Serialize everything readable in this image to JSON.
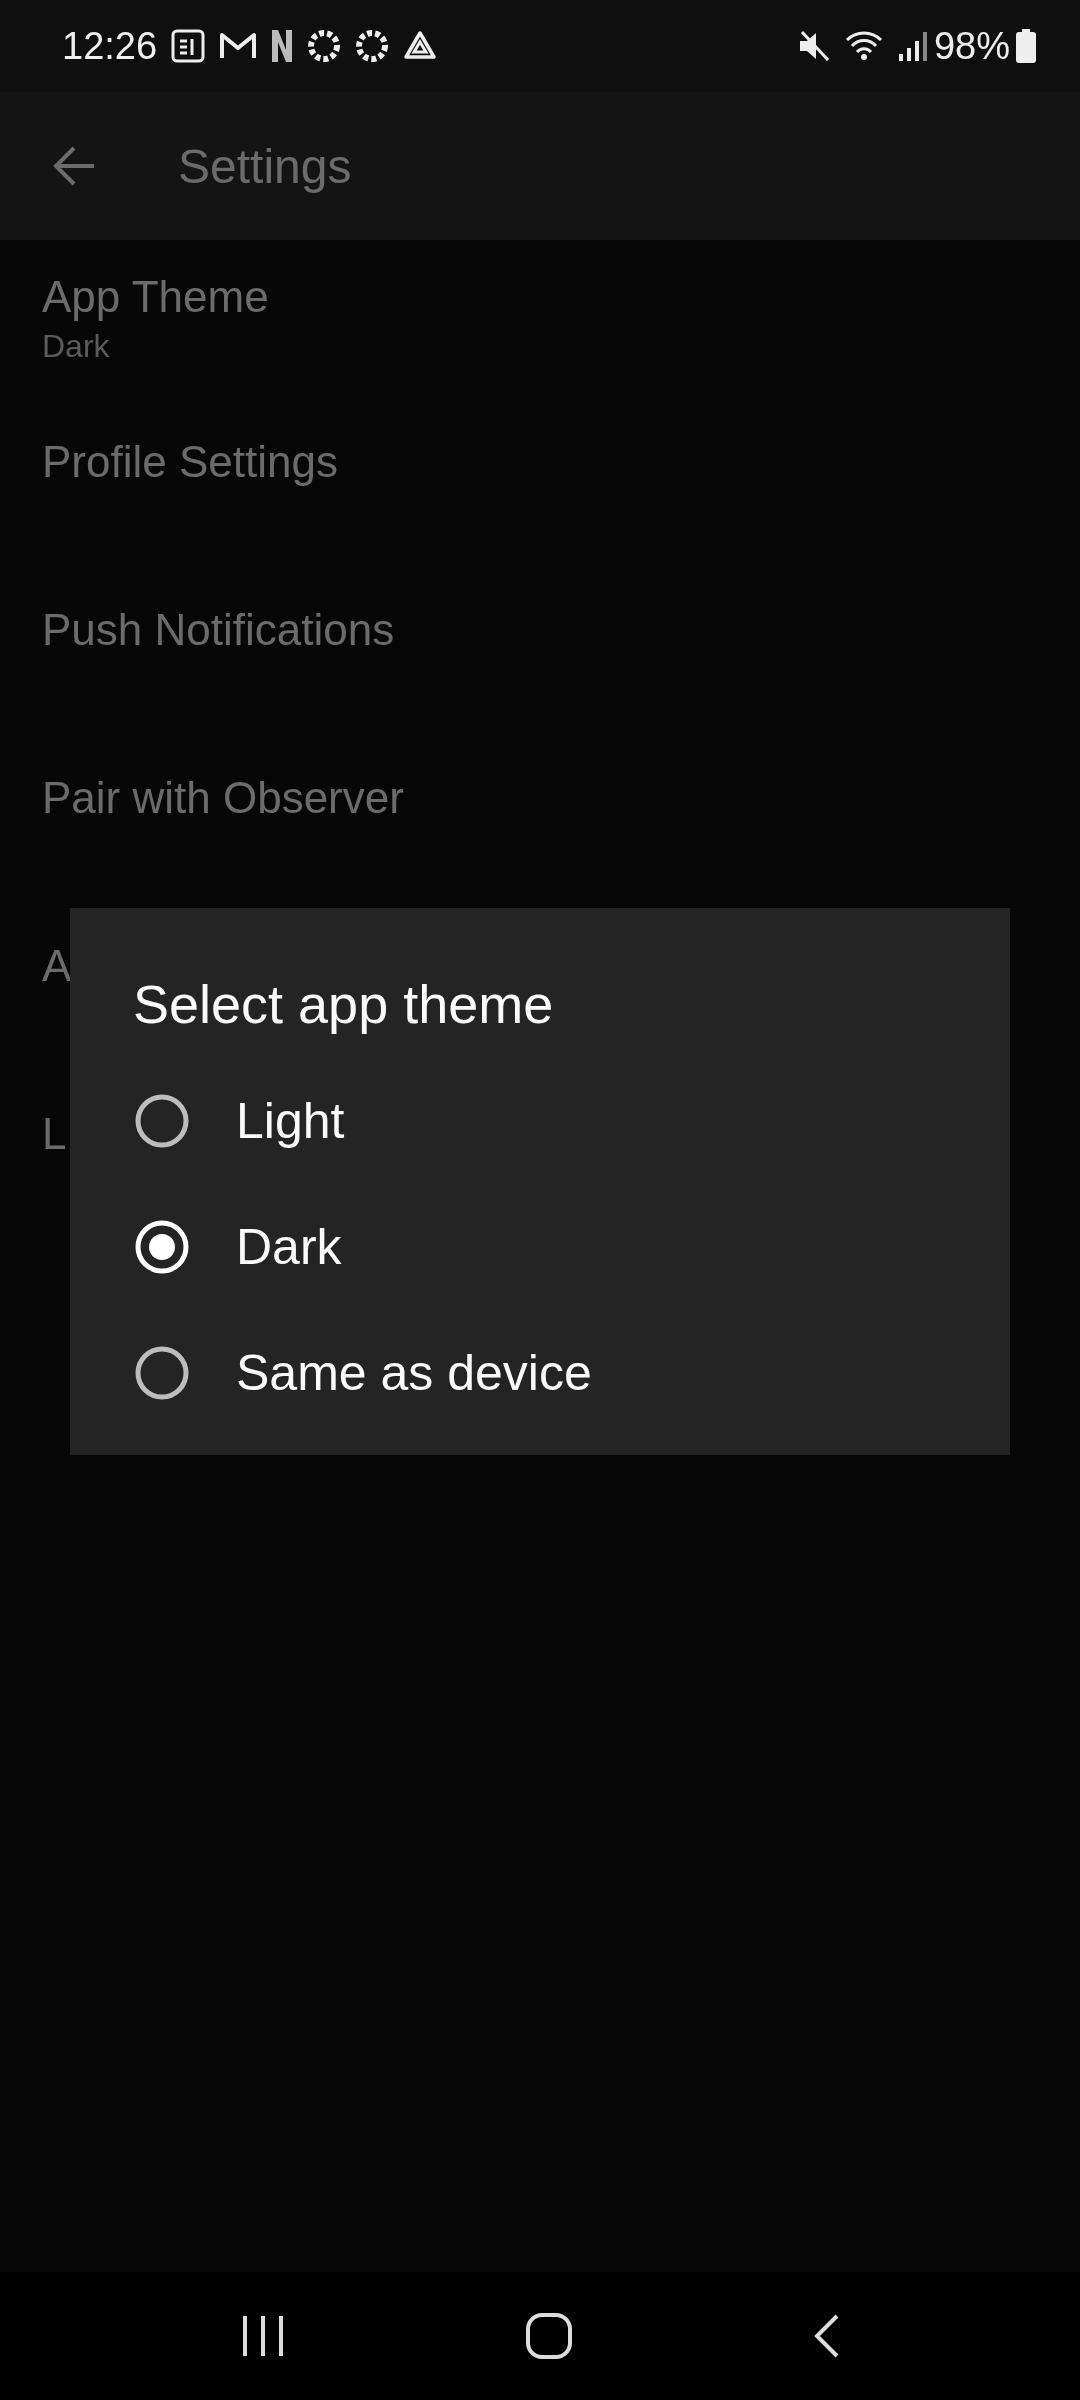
{
  "status_bar": {
    "time": "12:26",
    "battery": "98%"
  },
  "app_bar": {
    "title": "Settings"
  },
  "settings": [
    {
      "title": "App Theme",
      "subtitle": "Dark"
    },
    {
      "title": "Profile Settings"
    },
    {
      "title": "Push Notifications"
    },
    {
      "title": "Pair with Observer"
    },
    {
      "title": "A"
    },
    {
      "title": "L"
    }
  ],
  "dialog": {
    "title": "Select app theme",
    "options": [
      {
        "label": "Light",
        "selected": false
      },
      {
        "label": "Dark",
        "selected": true
      },
      {
        "label": "Same as device",
        "selected": false
      }
    ]
  }
}
